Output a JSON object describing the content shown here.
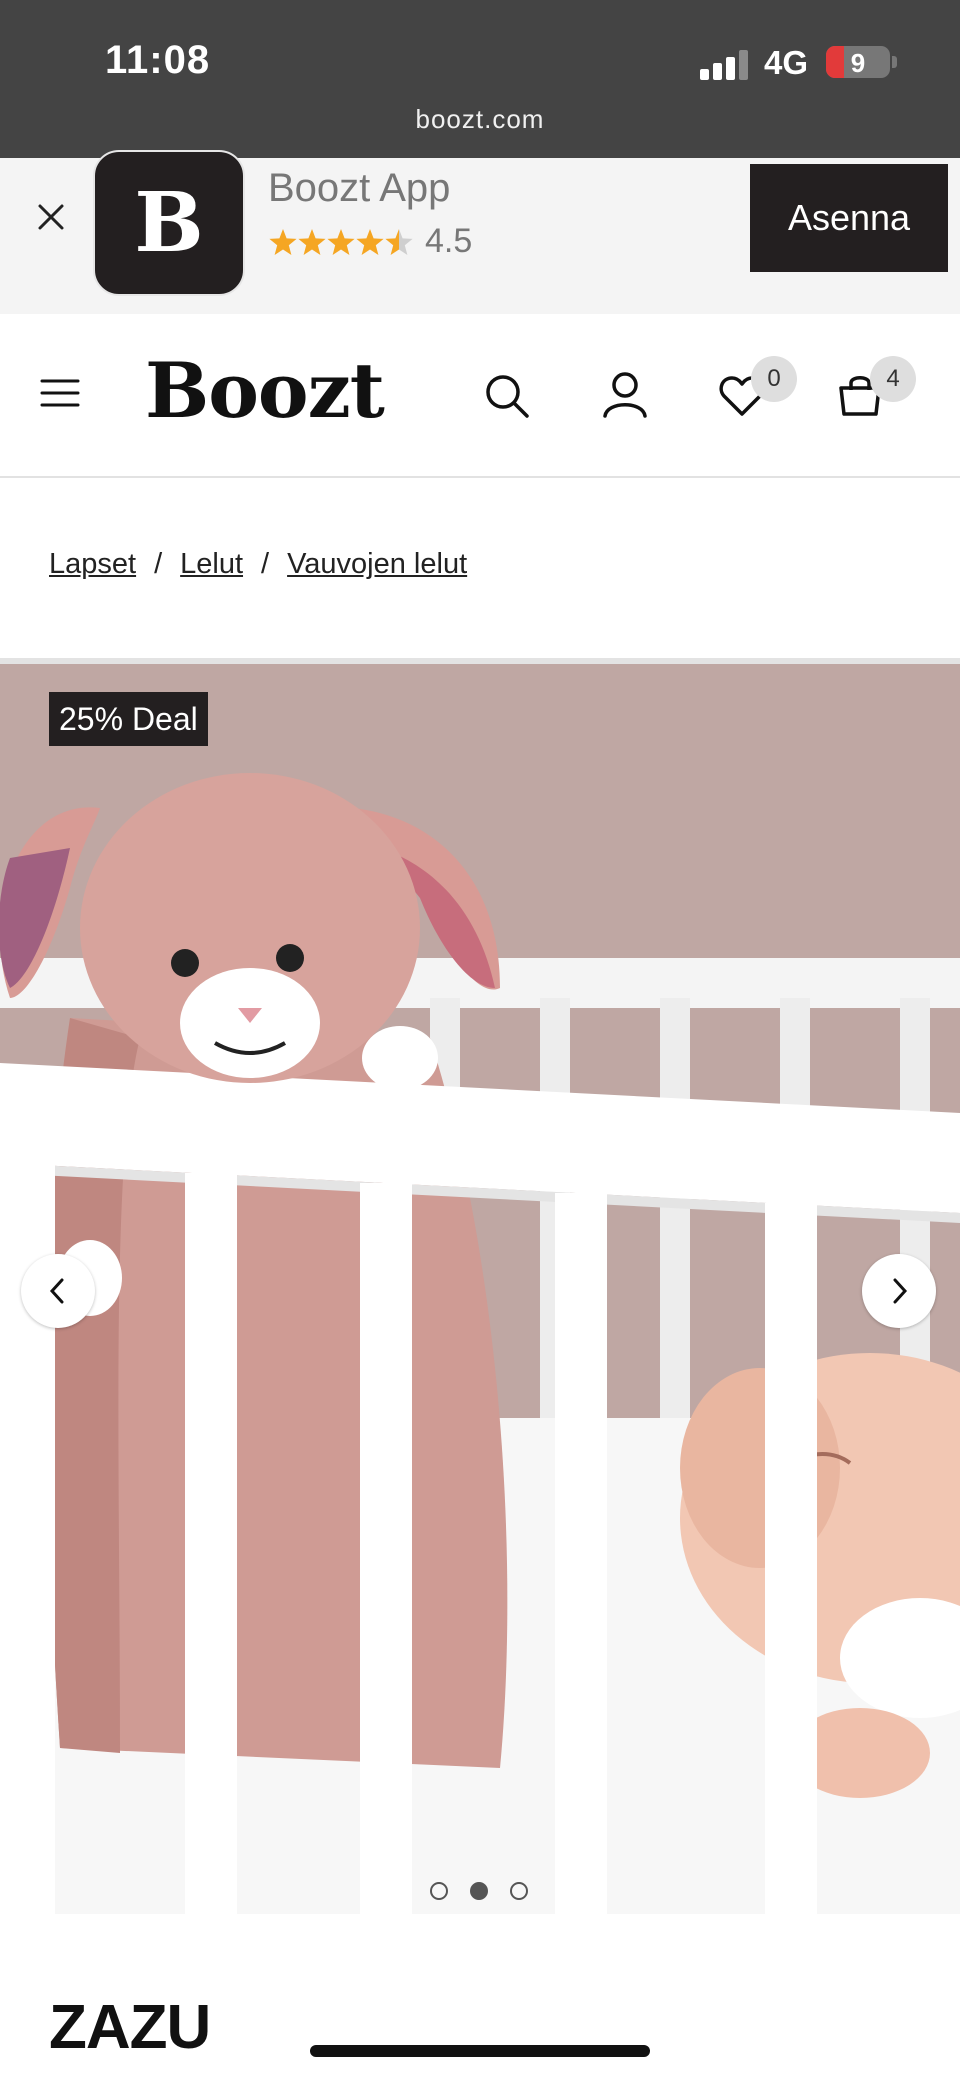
{
  "status_bar": {
    "time": "11:08",
    "network": "4G",
    "battery": "9",
    "url": "boozt.com"
  },
  "app_banner": {
    "logo_letter": "B",
    "app_name": "Boozt App",
    "rating": "4.5",
    "stars": 4.5,
    "install_label": "Asenna"
  },
  "header": {
    "logo": "Boozt",
    "wishlist_count": "0",
    "cart_count": "4"
  },
  "breadcrumb": [
    {
      "label": "Lapset"
    },
    {
      "label": "Lelut"
    },
    {
      "label": "Vauvojen lelut"
    }
  ],
  "breadcrumb_separator": "/",
  "product": {
    "badge": "25% Deal",
    "gallery": {
      "image_count": 3,
      "active_index": 2
    },
    "brand": "ZAZU"
  },
  "colors": {
    "status_bar": "#444444",
    "banner_bg": "#f4f4f4",
    "dark": "#231f20",
    "star": "#f5a623",
    "wall": "#bfa7a3",
    "plush": "#d4a29b"
  },
  "icons": [
    "close-icon",
    "menu-icon",
    "search-icon",
    "account-icon",
    "heart-icon",
    "cart-icon",
    "chevron-left-icon",
    "chevron-right-icon"
  ]
}
